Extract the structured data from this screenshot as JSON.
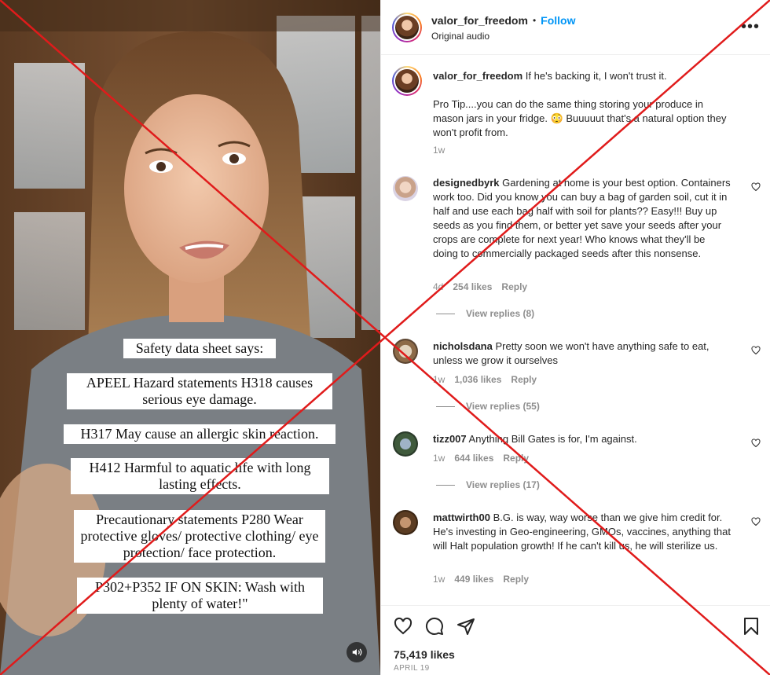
{
  "post": {
    "username": "valor_for_freedom",
    "follow_label": "Follow",
    "separator": "•",
    "audio": "Original audio"
  },
  "media": {
    "captions": [
      "Safety data sheet says:",
      "APEEL Hazard statements H318 causes serious eye damage.",
      "H317 May cause an allergic skin reaction.",
      "H412 Harmful to aquatic life with long lasting effects.",
      "Precautionary statements P280 Wear protective gloves/ protective clothing/ eye protection/ face protection.",
      "P302+P352 IF ON SKIN: Wash with plenty of water!\""
    ],
    "sound_icon": "speaker-icon"
  },
  "caption": {
    "username": "valor_for_freedom",
    "text1": "If he's backing it, I won't trust it.",
    "text2": "Pro Tip....you can do the same thing storing your produce in mason jars in your fridge. 😳 Buuuuut that's a natural option they won't profit from.",
    "age": "1w"
  },
  "comments": [
    {
      "username": "designedbyrk",
      "text": "Gardening at home is your best option. Containers work too. Did you know you can buy a bag of garden soil, cut it in half and use each bag half with soil for plants?? Easy!!! Buy up seeds as you find them, or better yet save your seeds after your crops are complete for next year! Who knows what they'll be doing to commercially packaged seeds after this nonsense.",
      "age": "4d",
      "likes": "254 likes",
      "reply": "Reply",
      "view_replies": "View replies (8)"
    },
    {
      "username": "nicholsdana",
      "text": "Pretty soon we won't have anything safe to eat, unless we grow it ourselves",
      "age": "1w",
      "likes": "1,036 likes",
      "reply": "Reply",
      "view_replies": "View replies (55)"
    },
    {
      "username": "tizz007",
      "text": "Anything Bill Gates is for, I'm against.",
      "age": "1w",
      "likes": "644 likes",
      "reply": "Reply",
      "view_replies": "View replies (17)"
    },
    {
      "username": "mattwirth00",
      "text": "B.G. is way, way worse than we give him credit for. He's investing in Geo-engineering, GMOs, vaccines, anything that will Halt population growth! If he can't kill us, he will sterilize us.",
      "age": "1w",
      "likes": "449 likes",
      "reply": "Reply"
    }
  ],
  "footer": {
    "likes": "75,419 likes",
    "date": "APRIL 19"
  },
  "colors": {
    "accent": "#0095f6",
    "overlay_x": "#e01b1b",
    "muted": "#8e8e8e"
  }
}
